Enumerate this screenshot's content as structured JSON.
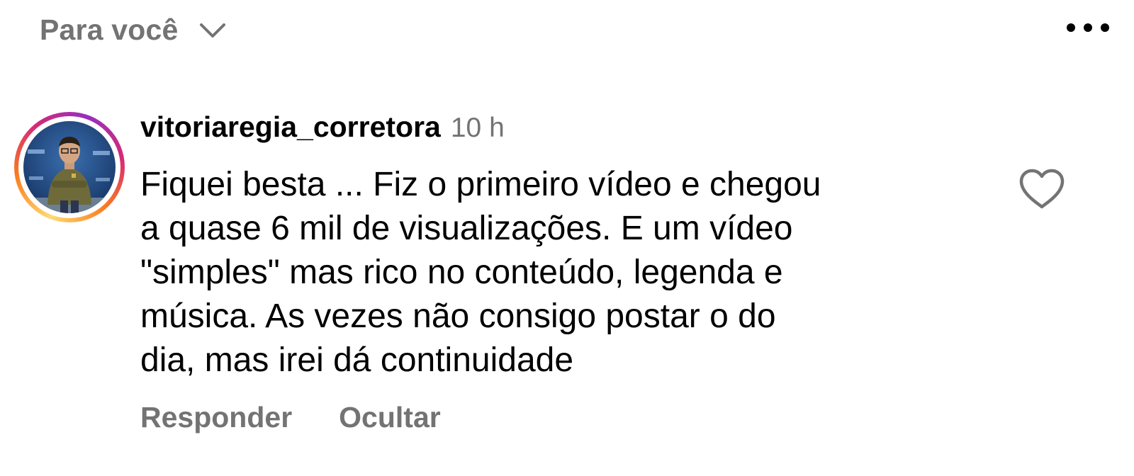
{
  "header": {
    "feed_label": "Para você",
    "dropdown_icon": "chevron-down-icon",
    "more_icon": "more-horizontal-icon"
  },
  "comment": {
    "username": "vitoriaregia_corretora",
    "time": "10 h",
    "text": "Fiquei besta ... Fiz o primeiro vídeo e chegou\na quase 6 mil de visualizações. E um vídeo\n\"simples\" mas rico no conteúdo, legenda e\nmúsica. As vezes não consigo postar o do\ndia, mas irei dá continuidade",
    "like_icon": "heart-icon",
    "actions": {
      "reply": "Responder",
      "hide": "Ocultar"
    }
  },
  "colors": {
    "muted_text": "#737373",
    "primary_text": "#000000",
    "story_ring": [
      "#feda75",
      "#fa7e1e",
      "#d62976",
      "#962fbf"
    ]
  }
}
